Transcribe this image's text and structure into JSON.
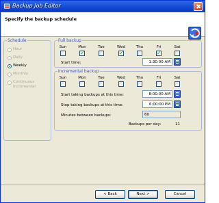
{
  "window": {
    "title": "Backup Job Editor"
  },
  "header": {
    "title": "Specify the backup schedule"
  },
  "schedule": {
    "label": "Schedule",
    "options": [
      {
        "label": "Hour",
        "checked": false,
        "enabled": false
      },
      {
        "label": "Daily",
        "checked": false,
        "enabled": false
      },
      {
        "label": "Weekly",
        "checked": true,
        "enabled": true
      },
      {
        "label": "Monthly",
        "checked": false,
        "enabled": false
      },
      {
        "label": "Continuous",
        "label2": "Incremental",
        "checked": false,
        "enabled": false
      }
    ]
  },
  "days": [
    "Sun",
    "Mon",
    "Tue",
    "Wed",
    "Thu",
    "Fri",
    "Sat"
  ],
  "full_backup": {
    "label": "Full backup",
    "checked": [
      false,
      true,
      false,
      true,
      false,
      true,
      false
    ],
    "start_time_label": "Start time:",
    "start_time": "1:30:00 AM"
  },
  "incremental_backup": {
    "label": "Incremental backup",
    "checked": [
      false,
      false,
      false,
      false,
      false,
      false,
      false
    ],
    "start_label": "Start taking backups at this time:",
    "start_time": "8:00:00 AM",
    "stop_label": "Stop taking backups at this time:",
    "stop_time": "6:00:00 PM",
    "minutes_label": "Minutes between backups:",
    "minutes": "60",
    "per_day_label": "Backups per day:",
    "per_day": "11"
  },
  "buttons": {
    "back": "< Back",
    "next": "Next >",
    "cancel": "Cancel"
  }
}
